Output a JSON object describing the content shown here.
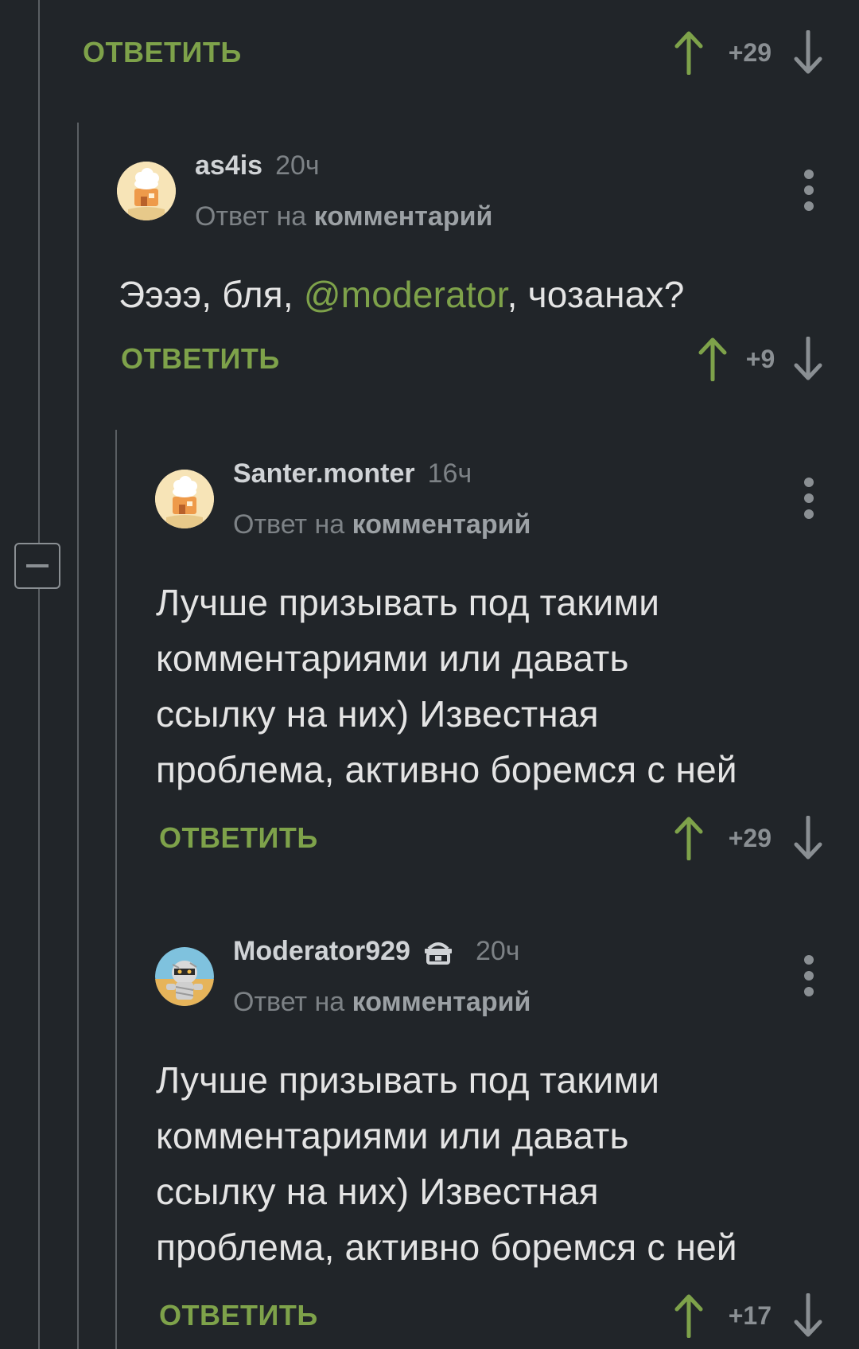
{
  "theme": {
    "background": "#212529",
    "accent": "#7ea24a",
    "muted": "#7d8286"
  },
  "top_action": {
    "reply_label": "ОТВЕТИТЬ",
    "votes": "+29"
  },
  "comments": [
    {
      "author": "as4is",
      "time": "20ч",
      "reply_prefix": "Ответ на",
      "reply_target": "комментарий",
      "body_before": "Ээээ, бля, ",
      "mention": "@moderator",
      "body_after": ", чозанах?",
      "reply_label": "ОТВЕТИТЬ",
      "votes": "+9",
      "avatar_icon": "chef-hat-house-icon"
    },
    {
      "author": "Santer.monter",
      "time": "16ч",
      "reply_prefix": "Ответ на",
      "reply_target": "комментарий",
      "body_lines": [
        "Лучше призывать под такими",
        "комментариями или давать",
        "ссылку на них) Известная",
        "проблема, активно боремся с ней"
      ],
      "reply_label": "ОТВЕТИТЬ",
      "votes": "+29",
      "avatar_icon": "chef-hat-house-icon"
    },
    {
      "author": "Moderator929",
      "time": "20ч",
      "reply_prefix": "Ответ на",
      "reply_target": "комментарий",
      "badge_icon": "moderator-badge-icon",
      "body_lines": [
        "Лучше призывать под такими",
        "комментариями или давать",
        "ссылку на них) Известная",
        "проблема, активно боремся с ней"
      ],
      "reply_label": "ОТВЕТИТЬ",
      "votes": "+17",
      "avatar_icon": "mummy-avatar-icon"
    }
  ]
}
